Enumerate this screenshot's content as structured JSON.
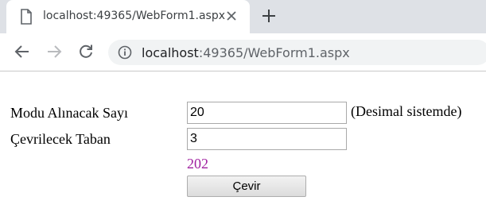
{
  "browser": {
    "tab": {
      "title": "localhost:49365/WebForm1.aspx"
    },
    "address_bar": {
      "host": "localhost",
      "rest": ":49365/WebForm1.aspx"
    },
    "icons": {
      "favicon": "page-icon",
      "close": "close-icon",
      "new_tab": "plus-icon",
      "back": "back-arrow-icon",
      "forward": "forward-arrow-icon",
      "reload": "reload-icon",
      "site_info": "info-icon"
    },
    "colors": {
      "tabstrip": "#dee1e6",
      "omnibox": "#f1f3f4"
    }
  },
  "form": {
    "modulo_label": "Modu Alınacak Sayı",
    "modulo_value": "20",
    "modulo_note": "(Desimal sistemde)",
    "base_label": "Çevrilecek Taban",
    "base_value": "3",
    "result": "202",
    "submit_label": "Çevir",
    "result_color": "#a020a0"
  }
}
